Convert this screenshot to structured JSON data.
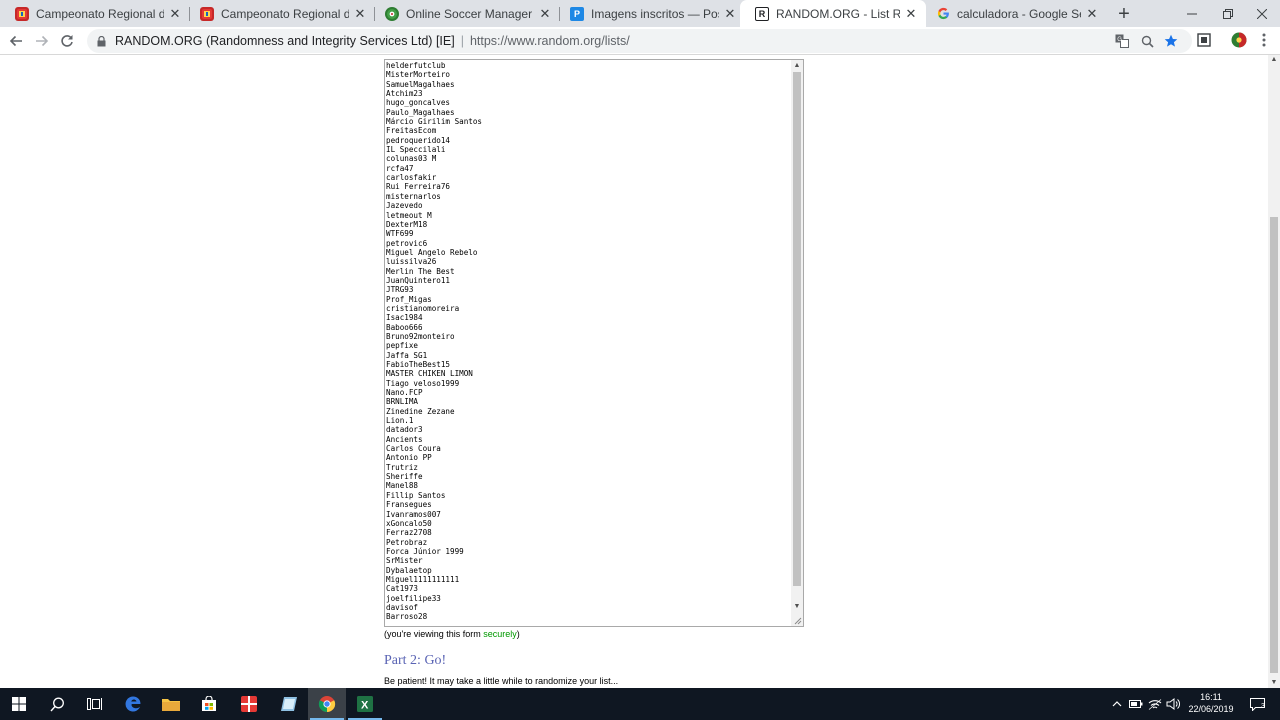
{
  "browser": {
    "tabs": [
      {
        "title": "Campeonato Regional de Portug",
        "favicon": "portugal-crest-icon",
        "active": false
      },
      {
        "title": "Campeonato Regional de Portug",
        "favicon": "portugal-crest-icon",
        "active": false
      },
      {
        "title": "Online Soccer Manager (OSM) -",
        "favicon": "osm-icon",
        "active": false
      },
      {
        "title": "Imagens inscritos — Postimage",
        "favicon": "postimage-icon",
        "active": false
      },
      {
        "title": "RANDOM.ORG - List Randomize",
        "favicon": "random-org-icon",
        "active": true
      },
      {
        "title": "calculadora - Google Search",
        "favicon": "google-icon",
        "active": false
      }
    ],
    "new_tab": "+",
    "omnibox": {
      "origin": "RANDOM.ORG (Randomness and Integrity Services Ltd) [IE]",
      "separator": "|",
      "url": "https://www.random.org/lists/"
    }
  },
  "page": {
    "list_items": [
      "helderfutclub",
      "MisterMorteiro",
      "SamuelMagalhaes",
      "Atchim23",
      "hugo_goncalves",
      "Paulo_Magalhaes",
      "Márcio Girilim Santos",
      "FreitasEcom",
      "pedroquerido14",
      "IL Speccilali",
      "colunas03 M",
      "rcfa47",
      "carlosfakir",
      "Rui Ferreira76",
      "misternarlos",
      "Jazevedo",
      "letmeout M",
      "DexterM18",
      "WTF699",
      "petrovic6",
      "Miguel Angelo Rebelo",
      "luissilva26",
      "Merlin The Best",
      "JuanQuintero11",
      "JTRG93",
      "Prof_Migas",
      "cristianomoreira",
      "Isac1984",
      "Baboo666",
      "Bruno92monteiro",
      "pepfixe",
      "Jaffa SG1",
      "FabioTheBest15",
      "MASTER CHIKEN LIMON",
      "Tiago veloso1999",
      "Nano.FCP",
      "BRNLIMA",
      "Zinedine Zezane",
      "Lion.1",
      "datador3",
      "Ancients",
      "Carlos Coura",
      "Antonio PP",
      "Trutriz",
      "Sheriffe",
      "Manel88",
      "Fillip Santos",
      "Fransegues",
      "Ivanramos007",
      "xGoncalo50",
      "Ferraz2708",
      "Petrobraz",
      "Forca Júnior 1999",
      "SrMister",
      "Dybalaetop",
      "Miguel1111111111",
      "Cat1973",
      "joelfilipe33",
      "davisof",
      "Barroso28"
    ],
    "secure_note": {
      "before": "(you're viewing this form ",
      "link": "securely",
      "after": ")"
    },
    "part2_heading": "Part 2: Go!",
    "patient_text": "Be patient! It may take a little while to randomize your list..."
  },
  "taskbar": {
    "time": "16:11",
    "date": "22/06/2019",
    "notifications_count": "3"
  },
  "colors": {
    "accent_blue": "#1a73e8",
    "secure_green": "#009900",
    "heading_purple": "#5a64b4",
    "taskbar": "#0f1722"
  }
}
